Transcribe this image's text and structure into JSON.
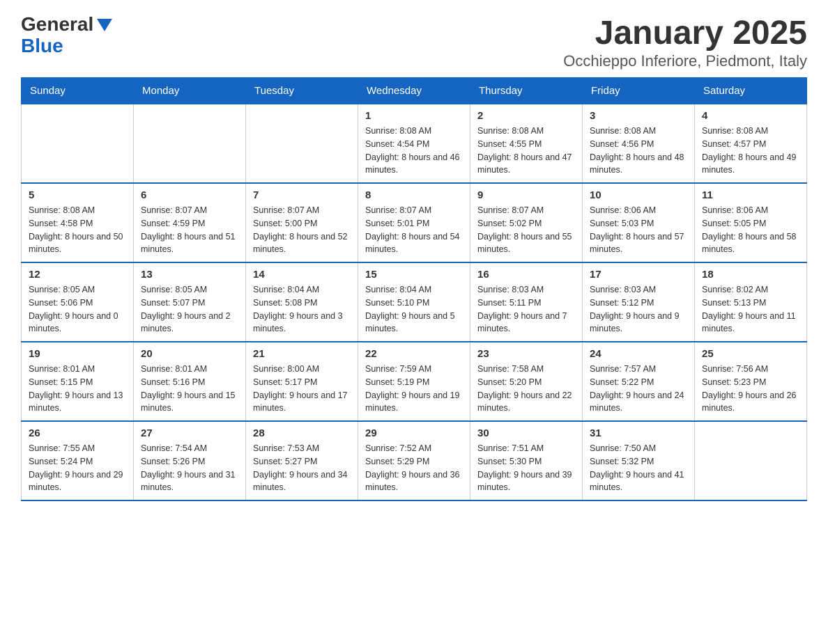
{
  "logo": {
    "general": "General",
    "blue": "Blue"
  },
  "title": "January 2025",
  "subtitle": "Occhieppo Inferiore, Piedmont, Italy",
  "days_of_week": [
    "Sunday",
    "Monday",
    "Tuesday",
    "Wednesday",
    "Thursday",
    "Friday",
    "Saturday"
  ],
  "weeks": [
    [
      {
        "day": "",
        "info": ""
      },
      {
        "day": "",
        "info": ""
      },
      {
        "day": "",
        "info": ""
      },
      {
        "day": "1",
        "info": "Sunrise: 8:08 AM\nSunset: 4:54 PM\nDaylight: 8 hours and 46 minutes."
      },
      {
        "day": "2",
        "info": "Sunrise: 8:08 AM\nSunset: 4:55 PM\nDaylight: 8 hours and 47 minutes."
      },
      {
        "day": "3",
        "info": "Sunrise: 8:08 AM\nSunset: 4:56 PM\nDaylight: 8 hours and 48 minutes."
      },
      {
        "day": "4",
        "info": "Sunrise: 8:08 AM\nSunset: 4:57 PM\nDaylight: 8 hours and 49 minutes."
      }
    ],
    [
      {
        "day": "5",
        "info": "Sunrise: 8:08 AM\nSunset: 4:58 PM\nDaylight: 8 hours and 50 minutes."
      },
      {
        "day": "6",
        "info": "Sunrise: 8:07 AM\nSunset: 4:59 PM\nDaylight: 8 hours and 51 minutes."
      },
      {
        "day": "7",
        "info": "Sunrise: 8:07 AM\nSunset: 5:00 PM\nDaylight: 8 hours and 52 minutes."
      },
      {
        "day": "8",
        "info": "Sunrise: 8:07 AM\nSunset: 5:01 PM\nDaylight: 8 hours and 54 minutes."
      },
      {
        "day": "9",
        "info": "Sunrise: 8:07 AM\nSunset: 5:02 PM\nDaylight: 8 hours and 55 minutes."
      },
      {
        "day": "10",
        "info": "Sunrise: 8:06 AM\nSunset: 5:03 PM\nDaylight: 8 hours and 57 minutes."
      },
      {
        "day": "11",
        "info": "Sunrise: 8:06 AM\nSunset: 5:05 PM\nDaylight: 8 hours and 58 minutes."
      }
    ],
    [
      {
        "day": "12",
        "info": "Sunrise: 8:05 AM\nSunset: 5:06 PM\nDaylight: 9 hours and 0 minutes."
      },
      {
        "day": "13",
        "info": "Sunrise: 8:05 AM\nSunset: 5:07 PM\nDaylight: 9 hours and 2 minutes."
      },
      {
        "day": "14",
        "info": "Sunrise: 8:04 AM\nSunset: 5:08 PM\nDaylight: 9 hours and 3 minutes."
      },
      {
        "day": "15",
        "info": "Sunrise: 8:04 AM\nSunset: 5:10 PM\nDaylight: 9 hours and 5 minutes."
      },
      {
        "day": "16",
        "info": "Sunrise: 8:03 AM\nSunset: 5:11 PM\nDaylight: 9 hours and 7 minutes."
      },
      {
        "day": "17",
        "info": "Sunrise: 8:03 AM\nSunset: 5:12 PM\nDaylight: 9 hours and 9 minutes."
      },
      {
        "day": "18",
        "info": "Sunrise: 8:02 AM\nSunset: 5:13 PM\nDaylight: 9 hours and 11 minutes."
      }
    ],
    [
      {
        "day": "19",
        "info": "Sunrise: 8:01 AM\nSunset: 5:15 PM\nDaylight: 9 hours and 13 minutes."
      },
      {
        "day": "20",
        "info": "Sunrise: 8:01 AM\nSunset: 5:16 PM\nDaylight: 9 hours and 15 minutes."
      },
      {
        "day": "21",
        "info": "Sunrise: 8:00 AM\nSunset: 5:17 PM\nDaylight: 9 hours and 17 minutes."
      },
      {
        "day": "22",
        "info": "Sunrise: 7:59 AM\nSunset: 5:19 PM\nDaylight: 9 hours and 19 minutes."
      },
      {
        "day": "23",
        "info": "Sunrise: 7:58 AM\nSunset: 5:20 PM\nDaylight: 9 hours and 22 minutes."
      },
      {
        "day": "24",
        "info": "Sunrise: 7:57 AM\nSunset: 5:22 PM\nDaylight: 9 hours and 24 minutes."
      },
      {
        "day": "25",
        "info": "Sunrise: 7:56 AM\nSunset: 5:23 PM\nDaylight: 9 hours and 26 minutes."
      }
    ],
    [
      {
        "day": "26",
        "info": "Sunrise: 7:55 AM\nSunset: 5:24 PM\nDaylight: 9 hours and 29 minutes."
      },
      {
        "day": "27",
        "info": "Sunrise: 7:54 AM\nSunset: 5:26 PM\nDaylight: 9 hours and 31 minutes."
      },
      {
        "day": "28",
        "info": "Sunrise: 7:53 AM\nSunset: 5:27 PM\nDaylight: 9 hours and 34 minutes."
      },
      {
        "day": "29",
        "info": "Sunrise: 7:52 AM\nSunset: 5:29 PM\nDaylight: 9 hours and 36 minutes."
      },
      {
        "day": "30",
        "info": "Sunrise: 7:51 AM\nSunset: 5:30 PM\nDaylight: 9 hours and 39 minutes."
      },
      {
        "day": "31",
        "info": "Sunrise: 7:50 AM\nSunset: 5:32 PM\nDaylight: 9 hours and 41 minutes."
      },
      {
        "day": "",
        "info": ""
      }
    ]
  ]
}
